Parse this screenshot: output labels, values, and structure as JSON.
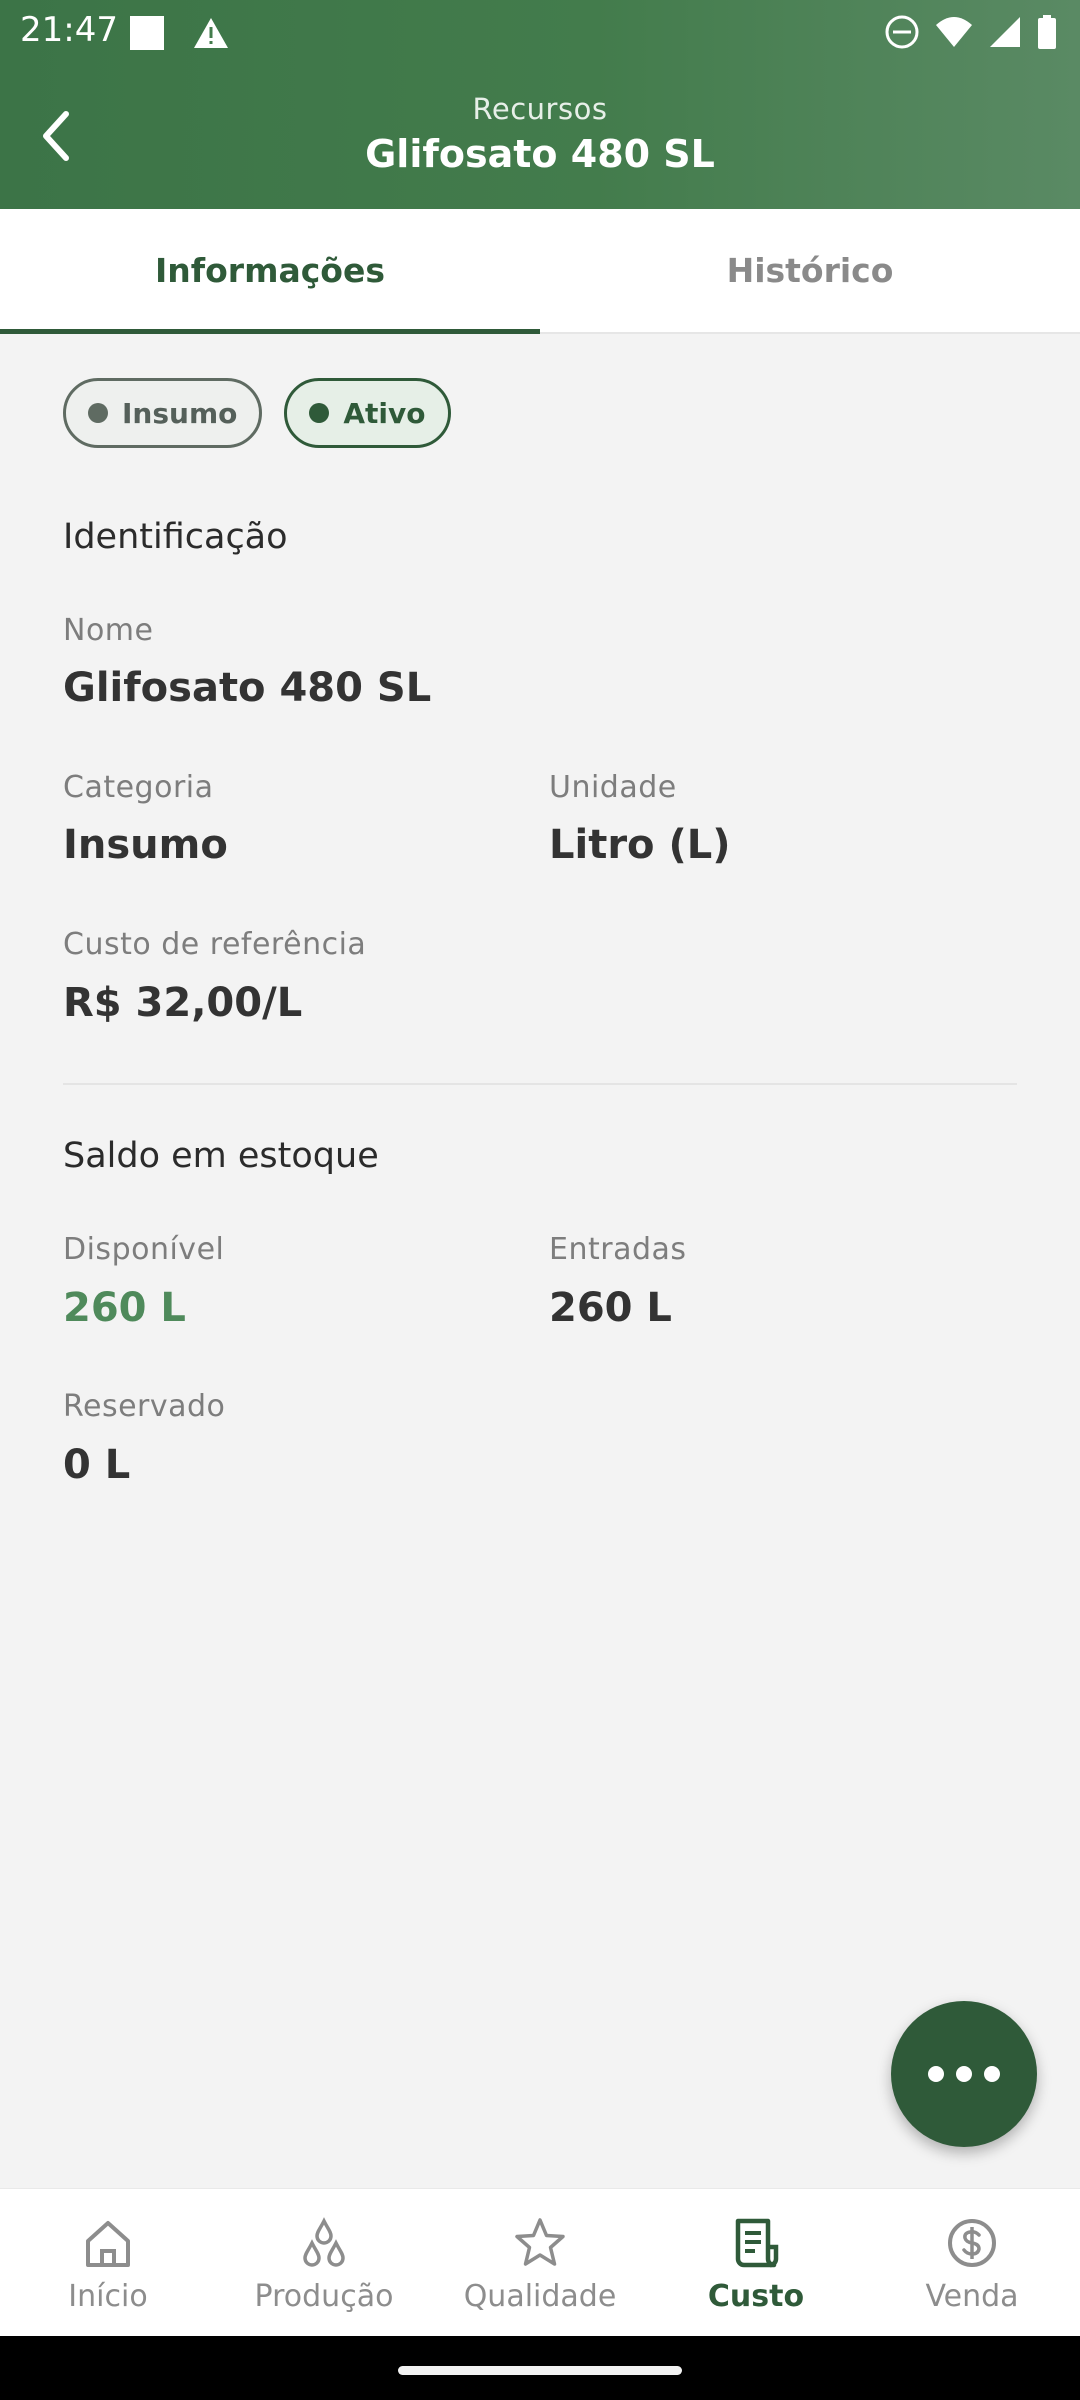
{
  "status_bar": {
    "time": "21:47"
  },
  "header": {
    "subtitle": "Recursos",
    "title": "Glifosato 480 SL"
  },
  "tabs": [
    {
      "label": "Informações",
      "active": true
    },
    {
      "label": "Histórico",
      "active": false
    }
  ],
  "chips": [
    {
      "label": "Insumo",
      "color": "#5f6b62"
    },
    {
      "label": "Ativo",
      "color": "#2f5a39"
    }
  ],
  "identification": {
    "section_title": "Identificação",
    "name_label": "Nome",
    "name_value": "Glifosato 480 SL",
    "category_label": "Categoria",
    "category_value": "Insumo",
    "unit_label": "Unidade",
    "unit_value": "Litro (L)",
    "ref_cost_label": "Custo de referência",
    "ref_cost_value": "R$ 32,00/L"
  },
  "stock": {
    "section_title": "Saldo em estoque",
    "available_label": "Disponível",
    "available_value": "260 L",
    "entries_label": "Entradas",
    "entries_value": "260 L",
    "reserved_label": "Reservado",
    "reserved_value": "0 L"
  },
  "bottom_nav": [
    {
      "label": "Início",
      "icon": "home-icon",
      "active": false
    },
    {
      "label": "Produção",
      "icon": "drops-icon",
      "active": false
    },
    {
      "label": "Qualidade",
      "icon": "star-icon",
      "active": false
    },
    {
      "label": "Custo",
      "icon": "receipt-icon",
      "active": true
    },
    {
      "label": "Venda",
      "icon": "dollar-circle-icon",
      "active": false
    }
  ],
  "colors": {
    "primary": "#2f5a39",
    "header": "#437c4c",
    "accent_green_text": "#4f8a5b"
  }
}
